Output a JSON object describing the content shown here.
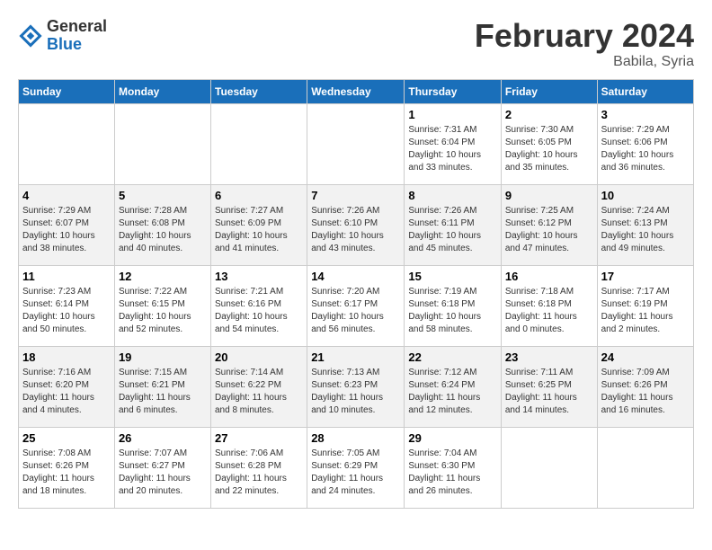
{
  "header": {
    "logo_general": "General",
    "logo_blue": "Blue",
    "month_title": "February 2024",
    "subtitle": "Babila, Syria"
  },
  "calendar": {
    "weekdays": [
      "Sunday",
      "Monday",
      "Tuesday",
      "Wednesday",
      "Thursday",
      "Friday",
      "Saturday"
    ],
    "weeks": [
      [
        {
          "day": "",
          "info": ""
        },
        {
          "day": "",
          "info": ""
        },
        {
          "day": "",
          "info": ""
        },
        {
          "day": "",
          "info": ""
        },
        {
          "day": "1",
          "info": "Sunrise: 7:31 AM\nSunset: 6:04 PM\nDaylight: 10 hours\nand 33 minutes."
        },
        {
          "day": "2",
          "info": "Sunrise: 7:30 AM\nSunset: 6:05 PM\nDaylight: 10 hours\nand 35 minutes."
        },
        {
          "day": "3",
          "info": "Sunrise: 7:29 AM\nSunset: 6:06 PM\nDaylight: 10 hours\nand 36 minutes."
        }
      ],
      [
        {
          "day": "4",
          "info": "Sunrise: 7:29 AM\nSunset: 6:07 PM\nDaylight: 10 hours\nand 38 minutes."
        },
        {
          "day": "5",
          "info": "Sunrise: 7:28 AM\nSunset: 6:08 PM\nDaylight: 10 hours\nand 40 minutes."
        },
        {
          "day": "6",
          "info": "Sunrise: 7:27 AM\nSunset: 6:09 PM\nDaylight: 10 hours\nand 41 minutes."
        },
        {
          "day": "7",
          "info": "Sunrise: 7:26 AM\nSunset: 6:10 PM\nDaylight: 10 hours\nand 43 minutes."
        },
        {
          "day": "8",
          "info": "Sunrise: 7:26 AM\nSunset: 6:11 PM\nDaylight: 10 hours\nand 45 minutes."
        },
        {
          "day": "9",
          "info": "Sunrise: 7:25 AM\nSunset: 6:12 PM\nDaylight: 10 hours\nand 47 minutes."
        },
        {
          "day": "10",
          "info": "Sunrise: 7:24 AM\nSunset: 6:13 PM\nDaylight: 10 hours\nand 49 minutes."
        }
      ],
      [
        {
          "day": "11",
          "info": "Sunrise: 7:23 AM\nSunset: 6:14 PM\nDaylight: 10 hours\nand 50 minutes."
        },
        {
          "day": "12",
          "info": "Sunrise: 7:22 AM\nSunset: 6:15 PM\nDaylight: 10 hours\nand 52 minutes."
        },
        {
          "day": "13",
          "info": "Sunrise: 7:21 AM\nSunset: 6:16 PM\nDaylight: 10 hours\nand 54 minutes."
        },
        {
          "day": "14",
          "info": "Sunrise: 7:20 AM\nSunset: 6:17 PM\nDaylight: 10 hours\nand 56 minutes."
        },
        {
          "day": "15",
          "info": "Sunrise: 7:19 AM\nSunset: 6:18 PM\nDaylight: 10 hours\nand 58 minutes."
        },
        {
          "day": "16",
          "info": "Sunrise: 7:18 AM\nSunset: 6:18 PM\nDaylight: 11 hours\nand 0 minutes."
        },
        {
          "day": "17",
          "info": "Sunrise: 7:17 AM\nSunset: 6:19 PM\nDaylight: 11 hours\nand 2 minutes."
        }
      ],
      [
        {
          "day": "18",
          "info": "Sunrise: 7:16 AM\nSunset: 6:20 PM\nDaylight: 11 hours\nand 4 minutes."
        },
        {
          "day": "19",
          "info": "Sunrise: 7:15 AM\nSunset: 6:21 PM\nDaylight: 11 hours\nand 6 minutes."
        },
        {
          "day": "20",
          "info": "Sunrise: 7:14 AM\nSunset: 6:22 PM\nDaylight: 11 hours\nand 8 minutes."
        },
        {
          "day": "21",
          "info": "Sunrise: 7:13 AM\nSunset: 6:23 PM\nDaylight: 11 hours\nand 10 minutes."
        },
        {
          "day": "22",
          "info": "Sunrise: 7:12 AM\nSunset: 6:24 PM\nDaylight: 11 hours\nand 12 minutes."
        },
        {
          "day": "23",
          "info": "Sunrise: 7:11 AM\nSunset: 6:25 PM\nDaylight: 11 hours\nand 14 minutes."
        },
        {
          "day": "24",
          "info": "Sunrise: 7:09 AM\nSunset: 6:26 PM\nDaylight: 11 hours\nand 16 minutes."
        }
      ],
      [
        {
          "day": "25",
          "info": "Sunrise: 7:08 AM\nSunset: 6:26 PM\nDaylight: 11 hours\nand 18 minutes."
        },
        {
          "day": "26",
          "info": "Sunrise: 7:07 AM\nSunset: 6:27 PM\nDaylight: 11 hours\nand 20 minutes."
        },
        {
          "day": "27",
          "info": "Sunrise: 7:06 AM\nSunset: 6:28 PM\nDaylight: 11 hours\nand 22 minutes."
        },
        {
          "day": "28",
          "info": "Sunrise: 7:05 AM\nSunset: 6:29 PM\nDaylight: 11 hours\nand 24 minutes."
        },
        {
          "day": "29",
          "info": "Sunrise: 7:04 AM\nSunset: 6:30 PM\nDaylight: 11 hours\nand 26 minutes."
        },
        {
          "day": "",
          "info": ""
        },
        {
          "day": "",
          "info": ""
        }
      ]
    ]
  }
}
